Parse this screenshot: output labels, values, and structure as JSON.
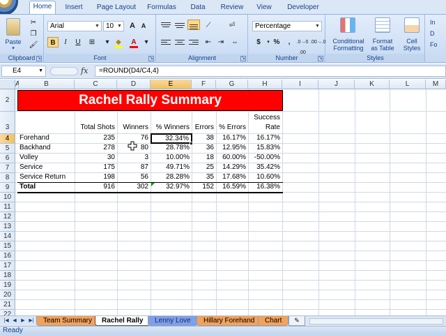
{
  "ribbon": {
    "tabs": [
      "Home",
      "Insert",
      "Page Layout",
      "Formulas",
      "Data",
      "Review",
      "View",
      "Developer"
    ],
    "active_tab": "Home",
    "clipboard": {
      "paste_label": "Paste",
      "group_label": "Clipboard"
    },
    "font": {
      "name": "Arial",
      "size": "10",
      "group_label": "Font",
      "bold": "B",
      "italic": "I",
      "underline": "U",
      "grow": "A",
      "shrink": "A"
    },
    "alignment": {
      "group_label": "Alignment"
    },
    "number": {
      "format": "Percentage",
      "group_label": "Number",
      "currency": "$",
      "percent": "%",
      "comma": ",",
      "inc_decimal": ".0→0 .00",
      "dec_decimal": ".00→.0"
    },
    "styles": {
      "group_label": "Styles",
      "cond_fmt_1": "Conditional",
      "cond_fmt_2": "Formatting",
      "fmt_table_1": "Format",
      "fmt_table_2": "as Table",
      "cell_styles_1": "Cell",
      "cell_styles_2": "Styles"
    },
    "cells_partial": [
      "In",
      "D",
      "Fo"
    ]
  },
  "formula_bar": {
    "name_box": "E4",
    "fx": "fx",
    "formula": "=ROUND(D4/C4,4)"
  },
  "grid": {
    "columns": [
      "A",
      "B",
      "C",
      "D",
      "E",
      "F",
      "G",
      "H",
      "I",
      "J",
      "K",
      "L",
      "M"
    ],
    "selected_column": "E",
    "rows": [
      "2",
      "3",
      "4",
      "5",
      "6",
      "7",
      "8",
      "9",
      "10",
      "11",
      "12",
      "13",
      "14",
      "15",
      "16",
      "17",
      "18",
      "19",
      "20",
      "21",
      "22"
    ],
    "selected_row": "4",
    "title": "Rachel Rally Summary",
    "headers": {
      "total_shots": "Total Shots",
      "winners": "Winners",
      "pct_winners": "% Winners",
      "errors": "Errors",
      "pct_errors": "% Errors",
      "success_rate_1": "Success",
      "success_rate_2": "Rate"
    },
    "data_rows": [
      {
        "label": "Forehand",
        "total_shots": "235",
        "winners": "76",
        "pct_winners": "32.34%",
        "errors": "38",
        "pct_errors": "16.17%",
        "success_rate": "16.17%"
      },
      {
        "label": "Backhand",
        "total_shots": "278",
        "winners": "80",
        "pct_winners": "28.78%",
        "errors": "36",
        "pct_errors": "12.95%",
        "success_rate": "15.83%"
      },
      {
        "label": "Volley",
        "total_shots": "30",
        "winners": "3",
        "pct_winners": "10.00%",
        "errors": "18",
        "pct_errors": "60.00%",
        "success_rate": "-50.00%"
      },
      {
        "label": "Service",
        "total_shots": "175",
        "winners": "87",
        "pct_winners": "49.71%",
        "errors": "25",
        "pct_errors": "14.29%",
        "success_rate": "35.42%"
      },
      {
        "label": "Service Return",
        "total_shots": "198",
        "winners": "56",
        "pct_winners": "28.28%",
        "errors": "35",
        "pct_errors": "17.68%",
        "success_rate": "10.60%"
      }
    ],
    "total_row": {
      "label": "Total",
      "total_shots": "916",
      "winners": "302",
      "pct_winners": "32.97%",
      "errors": "152",
      "pct_errors": "16.59%",
      "success_rate": "16.38%"
    }
  },
  "sheets": {
    "tabs": [
      {
        "label": "Team Summary",
        "color": "#f4a25a"
      },
      {
        "label": "Rachel Rally",
        "color": "#ffffff"
      },
      {
        "label": "Lenny Love",
        "color": "#7f9fe6"
      },
      {
        "label": "Hillary Forehand",
        "color": "#f4a25a"
      },
      {
        "label": "Chart",
        "color": "#f4a25a"
      }
    ],
    "active": "Rachel Rally"
  },
  "status": {
    "text": "Ready"
  }
}
